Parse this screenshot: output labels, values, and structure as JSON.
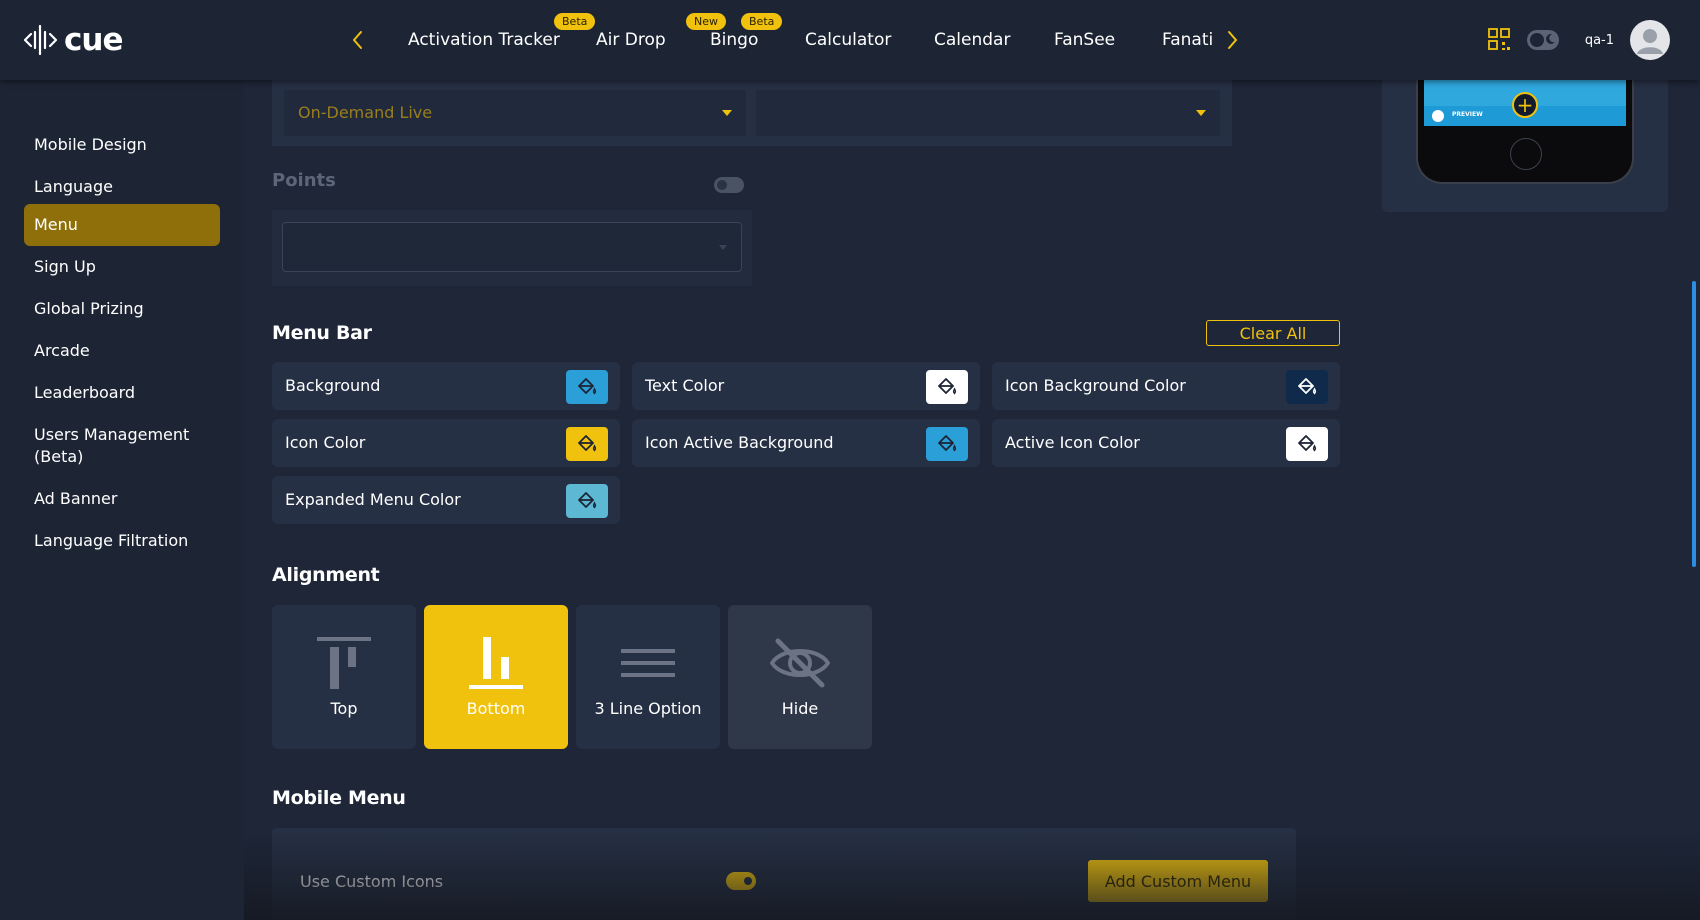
{
  "app": {
    "logo_text": "cue"
  },
  "nav": {
    "tabs": [
      {
        "label": "Activation Tracker",
        "badges": [
          "Beta"
        ]
      },
      {
        "label": "Air Drop",
        "badges": []
      },
      {
        "label": "Bingo",
        "badges": [
          "New",
          "Beta"
        ]
      },
      {
        "label": "Calculator",
        "badges": []
      },
      {
        "label": "Calendar",
        "badges": []
      },
      {
        "label": "FanSee",
        "badges": []
      },
      {
        "label": "Fanati",
        "badges": []
      }
    ]
  },
  "user": {
    "name": "qa-1"
  },
  "sidebar": {
    "items": [
      {
        "label": "Mobile Design",
        "active": false
      },
      {
        "label": "Language",
        "active": false
      },
      {
        "label": "Menu",
        "active": true
      },
      {
        "label": "Sign Up",
        "active": false
      },
      {
        "label": "Global Prizing",
        "active": false
      },
      {
        "label": "Arcade",
        "active": false
      },
      {
        "label": "Leaderboard",
        "active": false
      },
      {
        "label": "Users Management (Beta)",
        "active": false
      },
      {
        "label": "Ad Banner",
        "active": false
      },
      {
        "label": "Language Filtration",
        "active": false
      }
    ]
  },
  "top_selects": {
    "first_value": "On-Demand Live",
    "second_value": ""
  },
  "points": {
    "label": "Points",
    "enabled": false,
    "select_value": ""
  },
  "menu_bar": {
    "title": "Menu Bar",
    "clear_all_label": "Clear All",
    "colors": [
      {
        "label": "Background",
        "swatch": "#2b9fd8",
        "icon_color": "#1d2535"
      },
      {
        "label": "Text Color",
        "swatch": "#ffffff",
        "icon_color": "#1d2535"
      },
      {
        "label": "Icon Background Color",
        "swatch": "#0f2a4a",
        "icon_color": "#ffffff"
      },
      {
        "label": "Icon Color",
        "swatch": "#f0c20e",
        "icon_color": "#1d2535"
      },
      {
        "label": "Icon Active Background",
        "swatch": "#2b9fd8",
        "icon_color": "#1d2535"
      },
      {
        "label": "Active Icon Color",
        "swatch": "#ffffff",
        "icon_color": "#1d2535"
      },
      {
        "label": "Expanded Menu Color",
        "swatch": "#5db8d4",
        "icon_color": "#1d2535"
      }
    ]
  },
  "alignment": {
    "title": "Alignment",
    "options": [
      {
        "label": "Top",
        "selected": false,
        "icon": "align-top-icon"
      },
      {
        "label": "Bottom",
        "selected": true,
        "icon": "align-bottom-icon"
      },
      {
        "label": "3 Line Option",
        "selected": false,
        "icon": "three-line-icon"
      },
      {
        "label": "Hide",
        "selected": false,
        "icon": "eye-off-icon"
      }
    ]
  },
  "mobile_menu": {
    "title": "Mobile Menu",
    "custom_icons_label": "Use Custom Icons",
    "custom_icons_enabled": true,
    "add_button_label": "Add Custom Menu"
  },
  "colors": {
    "accent": "#f0c20e",
    "background": "#1e2638",
    "panel": "#263044"
  }
}
